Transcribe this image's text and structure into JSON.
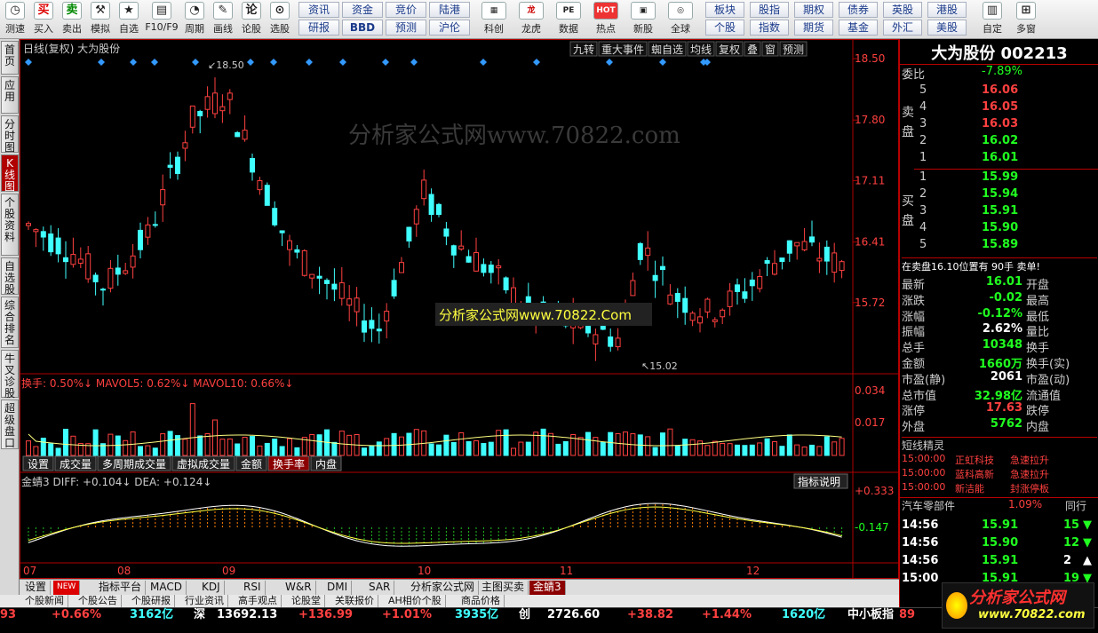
{
  "toolbar": {
    "items": [
      {
        "label": "测速",
        "icon": "clock-icon",
        "ch": "◷"
      },
      {
        "label": "买入",
        "icon": "buy-icon",
        "ch": "买"
      },
      {
        "label": "卖出",
        "icon": "sell-icon",
        "ch": "卖"
      },
      {
        "label": "模拟",
        "icon": "hammer-icon",
        "ch": "⚒"
      },
      {
        "label": "自选",
        "icon": "star-icon",
        "ch": "★"
      },
      {
        "label": "F10/F9",
        "icon": "f10-icon",
        "ch": "▤"
      },
      {
        "label": "周期",
        "icon": "cycle-icon",
        "ch": "◔"
      },
      {
        "label": "画线",
        "icon": "pen-icon",
        "ch": "✎"
      },
      {
        "label": "论股",
        "icon": "discuss-icon",
        "ch": "论"
      },
      {
        "label": "选股",
        "icon": "select-icon",
        "ch": "⊙"
      }
    ],
    "buttons1": [
      [
        "资讯",
        "研报"
      ],
      [
        "资金",
        "BBD"
      ],
      [
        "竞价",
        "预测"
      ],
      [
        "陆港",
        "沪伦"
      ]
    ],
    "items2": [
      {
        "label": "科创",
        "icon": "kechuang-icon",
        "ch": "▦"
      },
      {
        "label": "龙虎",
        "icon": "longhu-icon",
        "ch": "龙"
      },
      {
        "label": "数据",
        "icon": "data-icon",
        "ch": "PE"
      },
      {
        "label": "热点",
        "icon": "hot-icon",
        "ch": "HOT"
      },
      {
        "label": "新股",
        "icon": "newstock-icon",
        "ch": "▣"
      },
      {
        "label": "全球",
        "icon": "globe-icon",
        "ch": "◎"
      }
    ],
    "buttons2": [
      [
        "板块",
        "个股"
      ],
      [
        "股指",
        "指数"
      ],
      [
        "期权",
        "期货"
      ],
      [
        "债券",
        "基金"
      ],
      [
        "英股",
        "外汇"
      ],
      [
        "港股",
        "美股"
      ]
    ],
    "items3": [
      {
        "label": "自定",
        "icon": "custom-icon",
        "ch": "▥"
      },
      {
        "label": "多窗",
        "icon": "multiwindow-icon",
        "ch": "⊞"
      }
    ]
  },
  "lefttabs": [
    "首页",
    "应用",
    "分时图",
    "K线图",
    "个股资料",
    "自选股",
    "综合排名",
    "牛叉诊股",
    "超级盘口"
  ],
  "chart": {
    "header_left": "日线(复权)  大为股份",
    "header_buttons": [
      "九转",
      "重大事件",
      "蜘自选",
      "均线",
      "复权",
      "叠",
      "窗",
      "预测"
    ],
    "price_ticks": [
      "18.50",
      "17.80",
      "17.11",
      "16.41",
      "15.72"
    ],
    "max_label": "18.50",
    "min_label": "15.02",
    "watermark": "分析家公式网www.70822.com",
    "watermark_box": "分析家公式网www.70822.Com",
    "volume_label": "换手: 0.50%↓  MAVOL5: 0.62%↓  MAVOL10: 0.66%↓",
    "volume_ticks": [
      "0.034",
      "0.017"
    ],
    "vol_tabs": [
      "设置",
      "成交量",
      "多周期成交量",
      "虚拟成交量",
      "金额",
      "换手率",
      "内盘"
    ],
    "indicator_label": "金蜻3 DIFF: +0.104↓  DEA: +0.124↓",
    "indicator_btn": "指标说明",
    "ind_ticks": [
      "+0.333",
      "-0.147"
    ],
    "months": [
      "07",
      "08",
      "09",
      "10",
      "11",
      "12"
    ]
  },
  "bottomtabs": [
    "设置",
    "NEW",
    "指标平台",
    "MACD",
    "KDJ",
    "RSI",
    "W&R",
    "DMI",
    "SAR",
    "分析家公式网",
    "主图买卖",
    "金蜻3"
  ],
  "tabs2": [
    "个股新闻",
    "个股公告",
    "个股研报",
    "行业资讯",
    "高手观点",
    "论股堂",
    "关联报价",
    "AH相价个股",
    "商品价格"
  ],
  "right": {
    "title": "大为股份 002213",
    "webi": {
      "label": "委比",
      "value": "-7.89%"
    },
    "sell_label": "卖盘",
    "buy_label": "买盘",
    "sells": [
      [
        "5",
        "16.06"
      ],
      [
        "4",
        "16.05"
      ],
      [
        "3",
        "16.03"
      ],
      [
        "2",
        "16.02"
      ],
      [
        "1",
        "16.01"
      ]
    ],
    "buys": [
      [
        "1",
        "15.99"
      ],
      [
        "2",
        "15.94"
      ],
      [
        "3",
        "15.91"
      ],
      [
        "4",
        "15.90"
      ],
      [
        "5",
        "15.89"
      ]
    ],
    "notice": "在卖盘16.10位置有  90手  卖单!",
    "stats": [
      [
        "最新",
        "16.01",
        "开盘"
      ],
      [
        "涨跌",
        "-0.02",
        "最高"
      ],
      [
        "涨幅",
        "-0.12%",
        "最低"
      ],
      [
        "振幅",
        "2.62%",
        "量比"
      ],
      [
        "总手",
        "10348",
        "换手"
      ],
      [
        "金额",
        "1660万",
        "换手(实)"
      ],
      [
        "市盈(静)",
        "2061",
        "市盈(动)"
      ],
      [
        "总市值",
        "32.98亿",
        "流通值"
      ],
      [
        "涨停",
        "17.63",
        "跌停"
      ],
      [
        "外盘",
        "5762",
        "内盘"
      ]
    ],
    "sprite_title": "短线精灵",
    "sprites": [
      [
        "15:00:00",
        "正虹科技",
        "急速拉升"
      ],
      [
        "15:00:00",
        "蓝科高新",
        "急速拉升"
      ],
      [
        "15:00:00",
        "新洁能",
        "封涨停板"
      ]
    ],
    "sector": {
      "name": "汽车零部件",
      "change": "1.09%",
      "extra": "同行"
    },
    "trades": [
      [
        "14:56",
        "15.91",
        "15"
      ],
      [
        "14:56",
        "15.90",
        "12"
      ],
      [
        "14:56",
        "15.91",
        "2"
      ],
      [
        "15:00",
        "15.91",
        "19"
      ]
    ]
  },
  "status": {
    "a": "93",
    "b": "+0.66%",
    "c": "3162亿",
    "d": "深",
    "e": "13692.13",
    "f": "+136.99",
    "g": "+1.01%",
    "h": "3935亿",
    "i": "创",
    "j": "2726.60",
    "k": "+38.82",
    "l": "+1.44%",
    "m": "1620亿",
    "n": "中小板指",
    "o": "89"
  },
  "logo": {
    "text": "分析家公式网",
    "url": "www.70822.com"
  },
  "colors": {
    "up": "#ff4040",
    "down": "#40ffff",
    "frame": "#b00000"
  }
}
